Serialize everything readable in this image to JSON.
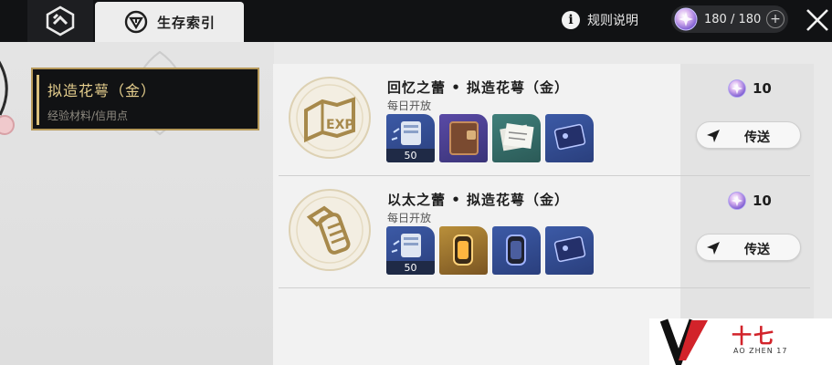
{
  "header": {
    "menu_icon": "hexagon-menu-icon",
    "tab_label": "生存索引",
    "tab_icon": "compass-triangle-icon",
    "rules_label": "规则说明",
    "power_value": "180 / 180",
    "power_plus": "+",
    "close_icon": "close-icon"
  },
  "sidebar": {
    "selected_item": {
      "title": "拟造花萼（金）",
      "subtitle": "经验材料/信用点"
    }
  },
  "entries": [
    {
      "title": "回忆之蕾 • 拟造花萼（金）",
      "subtitle": "每日开放",
      "emblem_icon": "book-exp-emblem-icon",
      "rewards": [
        {
          "icon": "exp-material-icon",
          "quality": "blue",
          "qty": "50"
        },
        {
          "icon": "book-icon",
          "quality": "purple",
          "qty": ""
        },
        {
          "icon": "paper-stack-icon",
          "quality": "teal",
          "qty": ""
        },
        {
          "icon": "card-icon",
          "quality": "blue",
          "qty": ""
        }
      ],
      "cost": "10",
      "teleport_label": "传送"
    },
    {
      "title": "以太之蕾 • 拟造花萼（金）",
      "subtitle": "每日开放",
      "emblem_icon": "canister-emblem-icon",
      "rewards": [
        {
          "icon": "exp-material-icon",
          "quality": "blue",
          "qty": "50"
        },
        {
          "icon": "gold-canister-icon",
          "quality": "gold",
          "qty": ""
        },
        {
          "icon": "dark-canister-icon",
          "quality": "blue",
          "qty": ""
        },
        {
          "icon": "card-icon",
          "quality": "blue",
          "qty": ""
        }
      ],
      "cost": "10",
      "teleport_label": "传送"
    }
  ],
  "watermark": {
    "cn": "十七",
    "en": "AO ZHEN 17"
  },
  "colors": {
    "topbar": "#111214",
    "gold_accent": "#d9bf7b",
    "panel": "#f2f2f2"
  }
}
